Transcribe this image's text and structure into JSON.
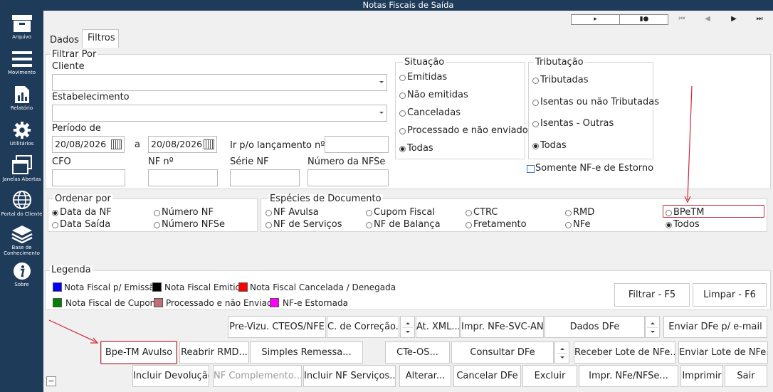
{
  "window": {
    "title": "Notas Fiscais de Saída"
  },
  "sidebar": {
    "items": [
      {
        "label": "Arquivo",
        "icon": "archive-icon"
      },
      {
        "label": "Movimento",
        "icon": "menu-icon"
      },
      {
        "label": "Relatório",
        "icon": "report-icon"
      },
      {
        "label": "Utilitários",
        "icon": "gear-icon"
      },
      {
        "label": "Janelas Abertas",
        "icon": "windows-icon"
      },
      {
        "label": "Portal do Cliente",
        "icon": "globe-icon"
      },
      {
        "label": "Base de Conhecimento",
        "icon": "layers-icon"
      },
      {
        "label": "Sobre",
        "icon": "info-icon"
      }
    ]
  },
  "tabs": [
    {
      "label": "Dados"
    },
    {
      "label": "Filtros"
    }
  ],
  "filtrar": {
    "legend": "Filtrar Por",
    "cliente_label": "Cliente",
    "estabelecimento_label": "Estabelecimento",
    "periodo_label": "Período de",
    "date_from": "20/08/2026",
    "date_sep": "a",
    "date_to": "20/08/2026",
    "ir_label": "Ir p/o lançamento nº",
    "cfo_label": "CFO",
    "nf_label": "NF nº",
    "serie_label": "Série NF",
    "nfse_label": "Número da NFSe"
  },
  "situacao": {
    "legend": "Situação",
    "options": [
      "Emitidas",
      "Não emitidas",
      "Canceladas",
      "Processado e não enviado",
      "Todas"
    ],
    "selected": "Todas"
  },
  "tributacao": {
    "legend": "Tributação",
    "options": [
      "Tributadas",
      "Isentas ou não Tributadas",
      "Isentas - Outras",
      "Todas"
    ],
    "selected": "Todas"
  },
  "estorno_label": "Somente NF-e de Estorno",
  "ordenar": {
    "legend": "Ordenar por",
    "options": [
      "Data da NF",
      "Número NF",
      "Data Saída",
      "Número NFSe"
    ],
    "selected": "Data da NF"
  },
  "especies": {
    "legend": "Espécies de Documento",
    "options": [
      "NF Avulsa",
      "Cupom Fiscal",
      "CTRC",
      "RMD",
      "BPeTM",
      "NF de Serviços",
      "NF de Balança",
      "Fretamento",
      "NFe",
      "Todos"
    ],
    "selected": "Todos"
  },
  "legenda": {
    "legend": "Legenda",
    "items": [
      {
        "label": "Nota Fiscal p/ Emissão",
        "color": "#0000ff"
      },
      {
        "label": "Nota Fiscal Emitida",
        "color": "#000000"
      },
      {
        "label": "Nota Fiscal Cancelada / Denegada",
        "color": "#ff0000"
      },
      {
        "label": "Nota Fiscal de Cupom",
        "color": "#008000"
      },
      {
        "label": "Processado e não Enviado",
        "color": "#c07070"
      },
      {
        "label": "NF-e Estornada",
        "color": "#ff00ff"
      }
    ]
  },
  "buttons": {
    "filtrar": "Filtrar - F5",
    "limpar": "Limpar - F6",
    "pre_vizu": "Pre-Vizu. CTEOS/NFE",
    "c_correcao": "C. de Correção...",
    "at_xml": "At. XML...",
    "impr_nfe_svc": "Impr. NFe-SVC-AN",
    "dados_dfe": "Dados DFe",
    "enviar_email": "Enviar DFe p/ e-mail",
    "bpe_avulso": "Bpe-TM Avulso",
    "reabrir_rmd": "Reabrir RMD...",
    "simples_remessa": "Simples Remessa...",
    "cte_os": "CTe-OS...",
    "consultar_dfe": "Consultar DFe",
    "receber_lote": "Receber Lote de NFe...",
    "enviar_lote": "Enviar Lote de NFe...",
    "incluir_devolucao": "Incluir Devolução",
    "nf_complemento": "NF Complemento...",
    "incluir_nf_servicos": "Incluir NF Serviços...",
    "alterar": "Alterar...",
    "cancelar_dfe": "Cancelar DFe",
    "excluir": "Excluir",
    "impr_nfe_nfse": "Impr. NFe/NFSe...",
    "imprimir": "Imprimir",
    "sair": "Sair"
  },
  "accent": {
    "sidebar": "#1f3b5a",
    "highlight": "#d0273a"
  }
}
